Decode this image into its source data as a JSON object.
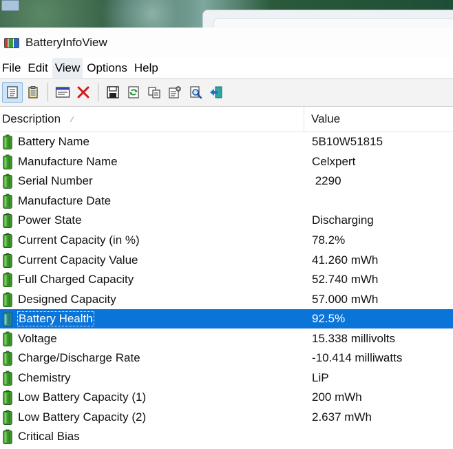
{
  "window": {
    "title": "BatteryInfoView"
  },
  "menu": [
    "File",
    "Edit",
    "View",
    "Options",
    "Help"
  ],
  "menu_active_index": 2,
  "toolbar": [
    {
      "icon": "html-report-selected-icon",
      "pressed": true
    },
    {
      "icon": "html-report-all-icon",
      "pressed": false
    },
    {
      "sep": true
    },
    {
      "icon": "properties-window-icon",
      "pressed": false
    },
    {
      "icon": "delete-icon",
      "pressed": false
    },
    {
      "sep": true
    },
    {
      "icon": "save-icon",
      "pressed": false
    },
    {
      "icon": "refresh-icon",
      "pressed": false
    },
    {
      "icon": "copy-icon",
      "pressed": false
    },
    {
      "icon": "properties-icon",
      "pressed": false
    },
    {
      "icon": "find-icon",
      "pressed": false
    },
    {
      "icon": "exit-icon",
      "pressed": false
    }
  ],
  "columns": {
    "description": "Description",
    "value": "Value"
  },
  "rows": [
    {
      "desc": "Battery Name",
      "value": "5B10W51815"
    },
    {
      "desc": "Manufacture Name",
      "value": "Celxpert"
    },
    {
      "desc": "Serial Number",
      "value": " 2290"
    },
    {
      "desc": "Manufacture Date",
      "value": ""
    },
    {
      "desc": "Power State",
      "value": "Discharging"
    },
    {
      "desc": "Current Capacity (in %)",
      "value": "78.2%"
    },
    {
      "desc": "Current Capacity Value",
      "value": "41.260 mWh"
    },
    {
      "desc": "Full Charged Capacity",
      "value": "52.740 mWh"
    },
    {
      "desc": "Designed Capacity",
      "value": "57.000 mWh"
    },
    {
      "desc": "Battery Health",
      "value": "92.5%",
      "selected": true
    },
    {
      "desc": "Voltage",
      "value": "15.338 millivolts"
    },
    {
      "desc": "Charge/Discharge Rate",
      "value": "-10.414 milliwatts"
    },
    {
      "desc": "Chemistry",
      "value": "LiP"
    },
    {
      "desc": "Low Battery Capacity (1)",
      "value": "200 mWh"
    },
    {
      "desc": "Low Battery Capacity (2)",
      "value": "2.637 mWh"
    },
    {
      "desc": "Critical Bias",
      "value": ""
    }
  ],
  "colors": {
    "selection": "#0a74d9",
    "battery_green": "#3e9a2e",
    "toolbar_bg": "#f3f3f3"
  }
}
